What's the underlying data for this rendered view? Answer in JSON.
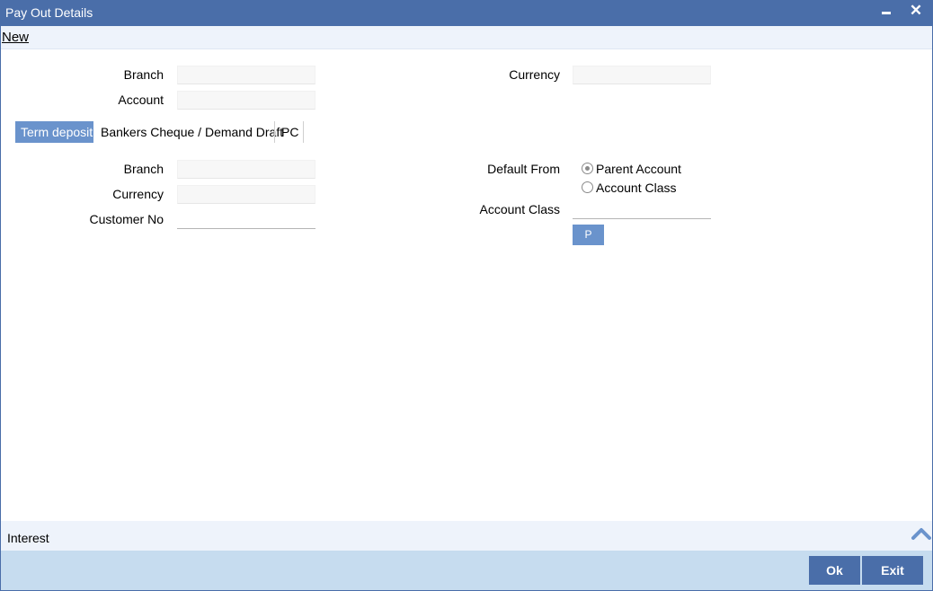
{
  "window": {
    "title": "Pay Out Details",
    "minimize_icon": "minimize-icon",
    "close_icon": "close-icon",
    "close_glyph": "✕"
  },
  "menu": {
    "new_label": "New"
  },
  "header_fields": {
    "branch_label": "Branch",
    "branch_value": "",
    "account_label": "Account",
    "account_value": "",
    "currency_label": "Currency",
    "currency_value": ""
  },
  "tabs": [
    {
      "label": "Term deposit",
      "active": true
    },
    {
      "label": "Bankers Cheque / Demand Draft",
      "active": false
    },
    {
      "label": "PC",
      "active": false
    }
  ],
  "term_deposit": {
    "branch_label": "Branch",
    "branch_value": "",
    "currency_label": "Currency",
    "currency_value": "",
    "customer_no_label": "Customer No",
    "customer_no_value": "",
    "default_from_label": "Default From",
    "default_from_options": [
      {
        "label": "Parent Account",
        "checked": true
      },
      {
        "label": "Account Class",
        "checked": false
      }
    ],
    "account_class_label": "Account Class",
    "account_class_value": "",
    "p_button_label": "P"
  },
  "interest": {
    "label": "Interest",
    "expand_icon": "chevron-up-icon"
  },
  "footer": {
    "ok_label": "Ok",
    "exit_label": "Exit"
  },
  "colors": {
    "titlebar": "#4a6ea9",
    "accent": "#6a93cc",
    "footer": "#c6dcef",
    "subbar": "#eef3fb"
  }
}
